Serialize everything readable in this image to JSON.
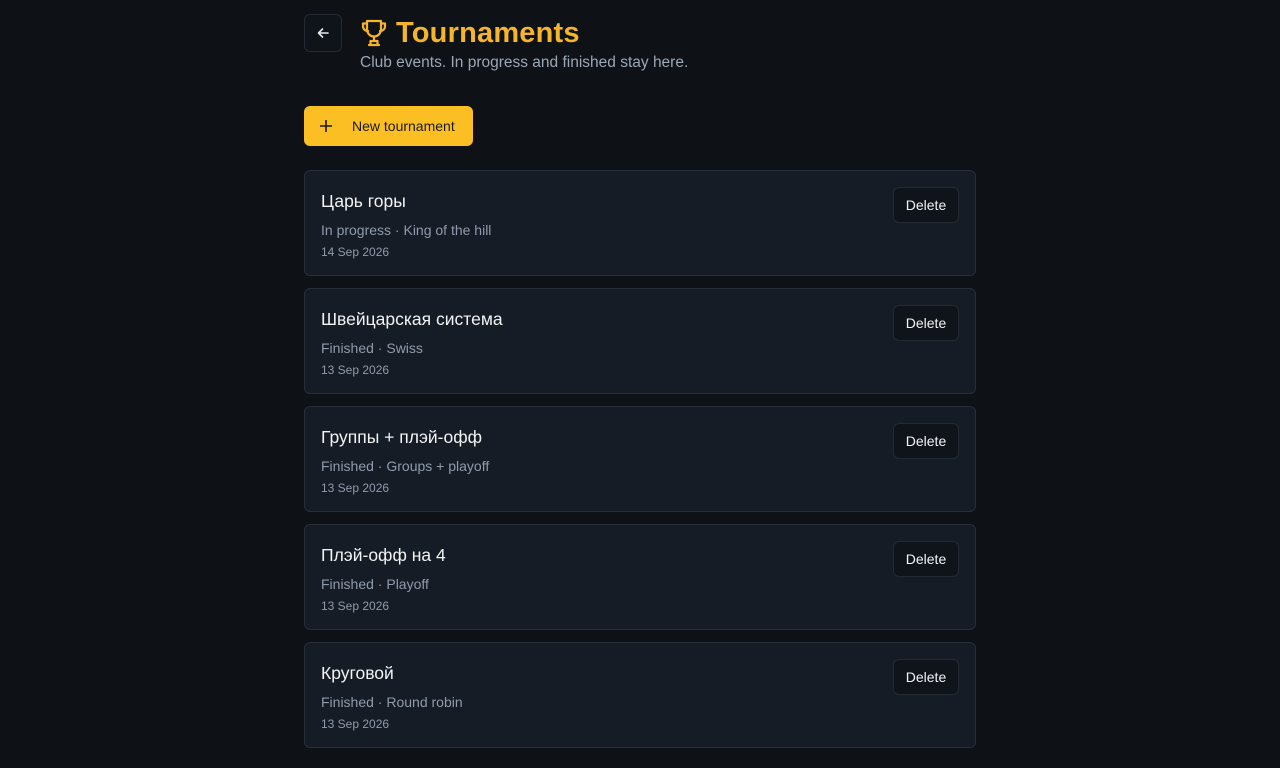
{
  "header": {
    "back_icon": "arrow-left-icon",
    "trophy_icon": "trophy-icon",
    "title": "Tournaments",
    "subtitle": "Club events. In progress and finished stay here.",
    "accent_color": "#f5b52a"
  },
  "toolbar": {
    "new_icon": "plus-icon",
    "new_label": "New tournament",
    "button_color": "#fbbf24"
  },
  "tournaments": [
    {
      "name": "Царь горы",
      "meta": "In progress · King of the hill",
      "date": "14 Sep 2026",
      "delete_label": "Delete"
    },
    {
      "name": "Швейцарская система",
      "meta": "Finished · Swiss",
      "date": "13 Sep 2026",
      "delete_label": "Delete"
    },
    {
      "name": "Группы + плэй-офф",
      "meta": "Finished · Groups + playoff",
      "date": "13 Sep 2026",
      "delete_label": "Delete"
    },
    {
      "name": "Плэй-офф на 4",
      "meta": "Finished · Playoff",
      "date": "13 Sep 2026",
      "delete_label": "Delete"
    },
    {
      "name": "Круговой",
      "meta": "Finished · Round robin",
      "date": "13 Sep 2026",
      "delete_label": "Delete"
    }
  ]
}
